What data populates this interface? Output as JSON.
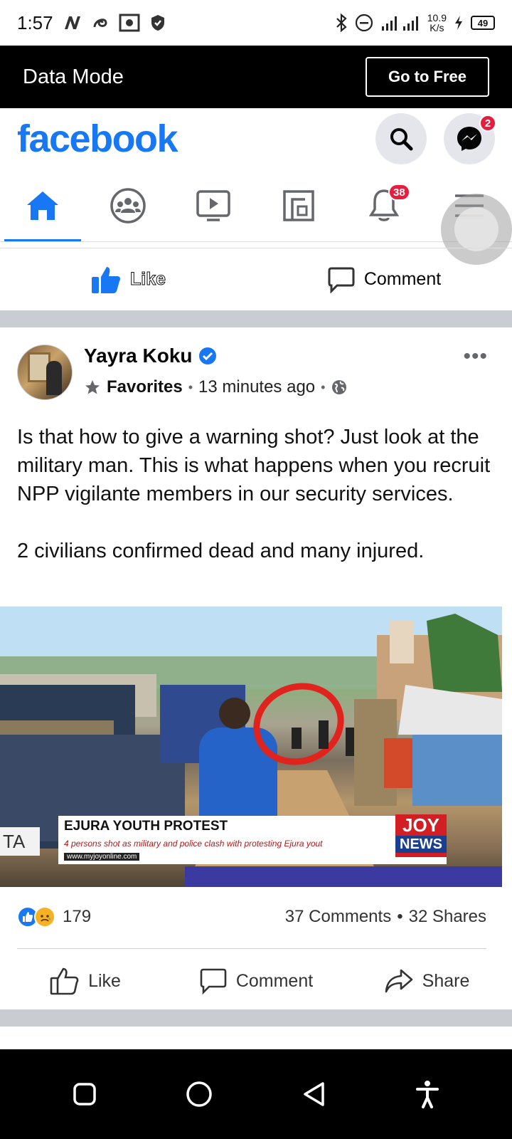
{
  "status_bar": {
    "time": "1:57",
    "network_speed_value": "10.9",
    "network_speed_unit": "K/s",
    "battery": "49"
  },
  "data_mode": {
    "label": "Data Mode",
    "button": "Go to Free"
  },
  "header": {
    "logo": "facebook",
    "messenger_badge": "2"
  },
  "tabs": [
    {
      "name": "home",
      "active": true
    },
    {
      "name": "groups"
    },
    {
      "name": "watch"
    },
    {
      "name": "pages"
    },
    {
      "name": "notifications",
      "badge": "38"
    },
    {
      "name": "menu"
    }
  ],
  "previous_post_actions": {
    "like": "Like",
    "comment": "Comment"
  },
  "post": {
    "author": "Yayra Koku",
    "verified": true,
    "audience": "Favorites",
    "time": "13 minutes ago",
    "text": "Is that how to give a warning shot? Just look at the military man. This is what happens when you recruit NPP vigilante members in our security services.\n\n2 civilians confirmed dead and many injured.",
    "media": {
      "ticker_title": "EJURA YOUTH PROTEST",
      "ticker_subtitle": "4 persons shot as military and police clash with protesting Ejura yout",
      "ticker_url": "www.myjoyonline.com",
      "logo_top": "JOY",
      "logo_bottom": "NEWS",
      "edge_text": "TA"
    },
    "reactions_count": "179",
    "comments": "37 Comments",
    "shares": "32 Shares",
    "actions": {
      "like": "Like",
      "comment": "Comment",
      "share": "Share"
    }
  },
  "colors": {
    "brand": "#1877f2",
    "badge": "#e41e3f",
    "separator": "#c9ccd1"
  }
}
